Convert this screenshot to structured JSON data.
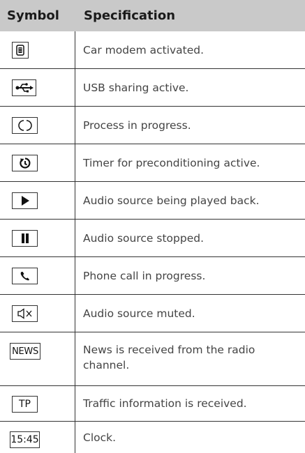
{
  "header": {
    "col_symbol": "Symbol",
    "col_spec": "Specification"
  },
  "rows": [
    {
      "icon": "car-modem-icon",
      "spec": "Car modem activated."
    },
    {
      "icon": "usb-icon",
      "spec": "USB sharing active."
    },
    {
      "icon": "process-icon",
      "spec": "Process in progress."
    },
    {
      "icon": "timer-icon",
      "spec": "Timer for preconditioning active."
    },
    {
      "icon": "play-icon",
      "spec": "Audio source being played back."
    },
    {
      "icon": "pause-icon",
      "spec": "Audio source stopped."
    },
    {
      "icon": "phone-icon",
      "spec": "Phone call in progress."
    },
    {
      "icon": "mute-icon",
      "spec": "Audio source muted."
    },
    {
      "icon": "news-icon",
      "label": "NEWS",
      "spec": "News is received from the radio channel."
    },
    {
      "icon": "tp-icon",
      "label": "TP",
      "spec": "Traffic information is received."
    },
    {
      "icon": "clock-icon",
      "label": "15:45",
      "spec": "Clock."
    }
  ]
}
